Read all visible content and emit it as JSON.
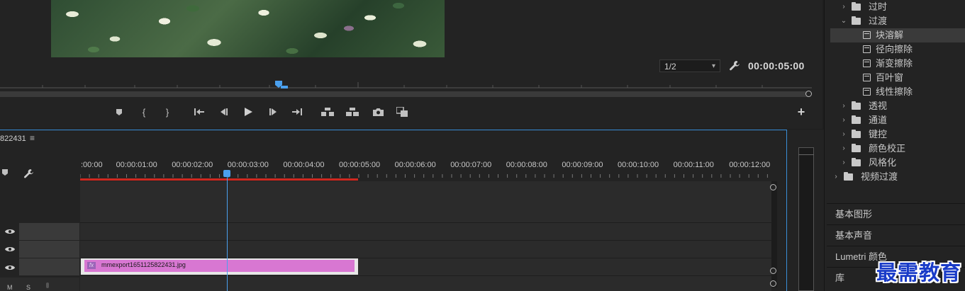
{
  "monitor": {
    "resolution": "1/2",
    "timecode": "00:00:05:00"
  },
  "transport": {
    "buttons": [
      "marker",
      "mark-in",
      "mark-out",
      "go-to-in",
      "step-back",
      "play",
      "step-forward",
      "go-to-out",
      "lift",
      "extract",
      "export-frame",
      "compare"
    ]
  },
  "timeline": {
    "sequence_name": "822431",
    "menu_glyph": "≡",
    "ruler_labels": [
      ":00:00",
      "00:00:01:00",
      "00:00:02:00",
      "00:00:03:00",
      "00:00:04:00",
      "00:00:05:00",
      "00:00:06:00",
      "00:00:07:00",
      "00:00:08:00",
      "00:00:09:00",
      "00:00:10:00",
      "00:00:11:00",
      "00:00:12:00"
    ],
    "track_header_labels": {
      "m": "M",
      "s": "S"
    },
    "clip": {
      "fx": "fx",
      "name": "mmexport1651125822431.jpg",
      "color": "#d877d2"
    },
    "playhead_color": "#4aa0ee",
    "work_area_color": "#d0281f"
  },
  "effects_panel": {
    "rows": [
      {
        "type": "folder",
        "label": "过时",
        "arrow": "›",
        "indent": 1
      },
      {
        "type": "folder",
        "label": "过渡",
        "arrow": "⌄",
        "indent": 1
      },
      {
        "type": "effect",
        "label": "块溶解",
        "selected": true
      },
      {
        "type": "effect",
        "label": "径向擦除"
      },
      {
        "type": "effect",
        "label": "渐变擦除"
      },
      {
        "type": "effect",
        "label": "百叶窗"
      },
      {
        "type": "effect",
        "label": "线性擦除"
      },
      {
        "type": "folder",
        "label": "透视",
        "arrow": "›",
        "indent": 1
      },
      {
        "type": "folder",
        "label": "通道",
        "arrow": "›",
        "indent": 1
      },
      {
        "type": "folder",
        "label": "键控",
        "arrow": "›",
        "indent": 1
      },
      {
        "type": "folder",
        "label": "颜色校正",
        "arrow": "›",
        "indent": 1
      },
      {
        "type": "folder",
        "label": "风格化",
        "arrow": "›",
        "indent": 1
      },
      {
        "type": "folder",
        "label": "视频过渡",
        "arrow": "›",
        "indent": 0
      }
    ],
    "panels": [
      "基本图形",
      "基本声音",
      "Lumetri 颜色",
      "库"
    ]
  },
  "watermark": "最需教育"
}
